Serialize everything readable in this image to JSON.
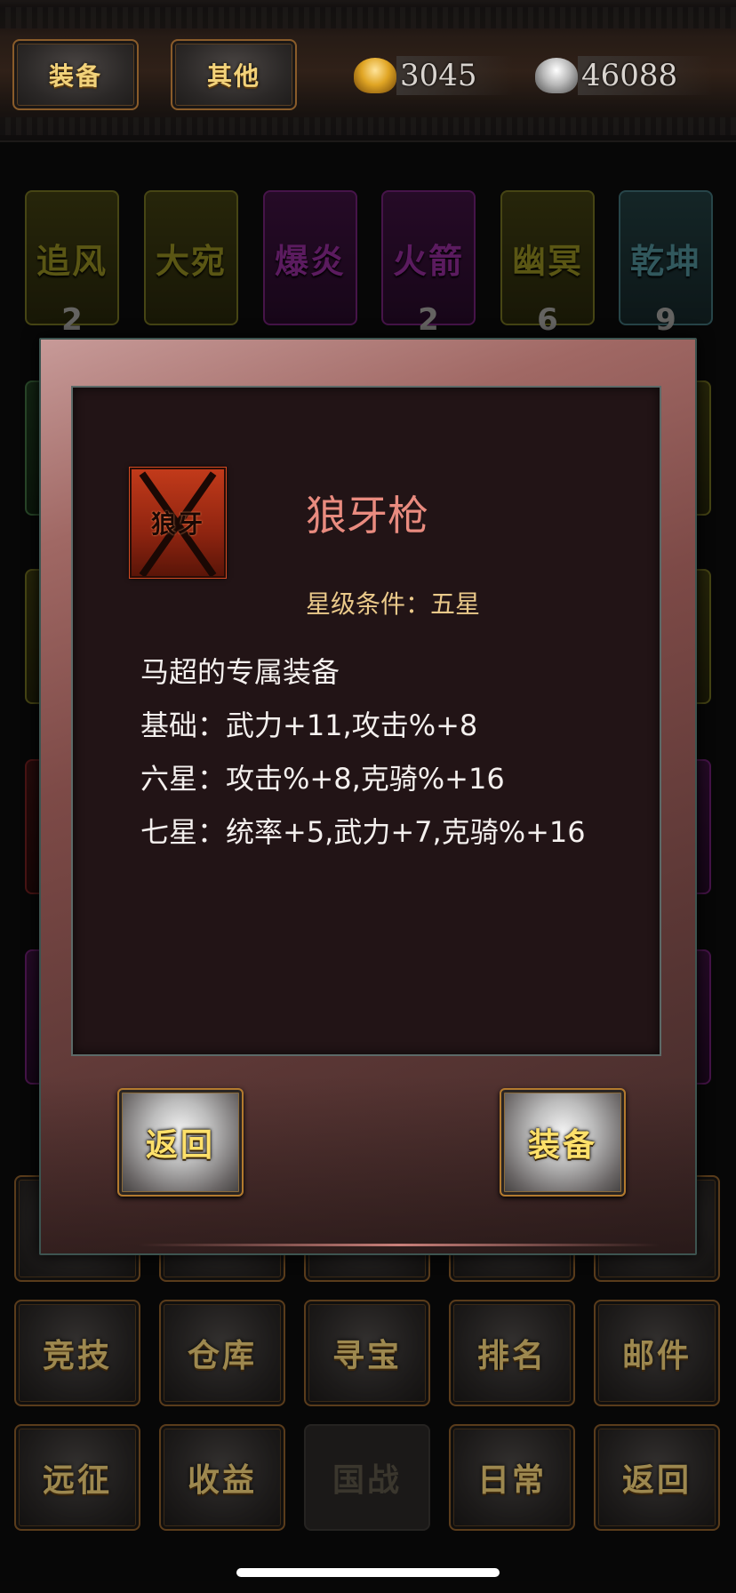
{
  "topbar": {
    "tab_equip": "装备",
    "tab_other": "其他",
    "gold_value": "3045",
    "silver_value": "46088"
  },
  "cards_row1": [
    {
      "name": "追风",
      "color": "yellow",
      "count": "2"
    },
    {
      "name": "大宛",
      "color": "yellow",
      "count": ""
    },
    {
      "name": "爆炎",
      "color": "purple",
      "count": ""
    },
    {
      "name": "火箭",
      "color": "purple",
      "count": "2"
    },
    {
      "name": "幽冥",
      "color": "yellow",
      "count": "6"
    },
    {
      "name": "乾坤",
      "color": "teal",
      "count": "9"
    }
  ],
  "modal": {
    "item_name": "狼牙枪",
    "item_icon_text": "狼牙",
    "star_condition": "星级条件：五星",
    "description": [
      "马超的专属装备",
      "基础：武力+11,攻击%+8",
      "六星：攻击%+8,克骑%+16",
      "七星：统率+5,武力+7,克骑%+16"
    ],
    "back_button": "返回",
    "equip_button": "装备"
  },
  "menu": {
    "row2": [
      "竞技",
      "仓库",
      "寻宝",
      "排名",
      "邮件"
    ],
    "row3": [
      "远征",
      "收益",
      "国战",
      "日常",
      "返回"
    ]
  },
  "colors": {
    "gold_text": "#f2d27a",
    "item_name": "#e98b7f",
    "star_condition": "#eac98a"
  }
}
